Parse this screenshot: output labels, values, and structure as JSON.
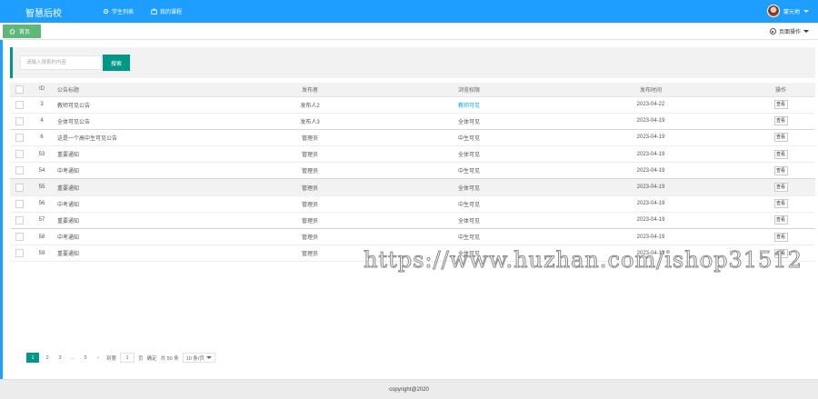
{
  "app": {
    "logo": "智慧后校",
    "user_name": "蒙元地"
  },
  "nav": [
    {
      "label": "学生列表",
      "icon": "gear-icon"
    },
    {
      "label": "我的课程",
      "icon": "briefcase-icon"
    }
  ],
  "tabs": {
    "home_label": "首页",
    "page_ops_label": "页面操作"
  },
  "search": {
    "placeholder": "请输入搜索的内容",
    "button_label": "搜索"
  },
  "table": {
    "headers": [
      "ID",
      "公告标题",
      "发布者",
      "浏览权限",
      "发布时间",
      "操作"
    ],
    "rows": [
      {
        "id": "3",
        "title": "教师可见公告",
        "publisher": "发布人2",
        "audience": "教师可见",
        "time": "2023-04-22",
        "action": "查看",
        "audience_link": true
      },
      {
        "id": "4",
        "title": "全体可见公告",
        "publisher": "发布人3",
        "audience": "全体可见",
        "time": "2023-04-19",
        "action": "查看"
      },
      {
        "id": "6",
        "title": "这是一个高中生可见公告",
        "publisher": "管理员",
        "audience": "中生可见",
        "time": "2023-04-19",
        "action": "查看"
      },
      {
        "id": "53",
        "title": "重要通知",
        "publisher": "管理员",
        "audience": "全体可见",
        "time": "2023-04-19",
        "action": "查看"
      },
      {
        "id": "54",
        "title": "中考通知",
        "publisher": "管理员",
        "audience": "中生可见",
        "time": "2023-04-19",
        "action": "查看"
      },
      {
        "id": "55",
        "title": "重要通知",
        "publisher": "管理员",
        "audience": "全体可见",
        "time": "2023-04-19",
        "action": "查看",
        "highlight": true
      },
      {
        "id": "56",
        "title": "中考通知",
        "publisher": "管理员",
        "audience": "中生可见",
        "time": "2023-04-19",
        "action": "查看"
      },
      {
        "id": "57",
        "title": "重要通知",
        "publisher": "管理员",
        "audience": "全体可见",
        "time": "2023-04-19",
        "action": "查看"
      },
      {
        "id": "58",
        "title": "中考通知",
        "publisher": "管理员",
        "audience": "中生可见",
        "time": "2023-04-19",
        "action": "查看"
      },
      {
        "id": "59",
        "title": "重要通知",
        "publisher": "管理员",
        "audience": "全体可见",
        "time": "2023-04-19",
        "action": "查看"
      }
    ]
  },
  "pagination": {
    "prev": "‹",
    "pages": [
      "1",
      "2",
      "3"
    ],
    "ellipsis": "…",
    "last": "5",
    "next": "›",
    "goto_label": "到第",
    "goto_value": "1",
    "page_unit": "页",
    "confirm": "确定",
    "total": "共 50 条",
    "page_size": "10 条/页",
    "active_page": "1"
  },
  "footer": {
    "copyright": "copyright@2020"
  },
  "watermark": "https://www.huzhan.com/ishop31512",
  "colors": {
    "topbar": "#1e9fff",
    "tab_home": "#5fb878",
    "primary": "#009688",
    "link": "#01aaed"
  }
}
